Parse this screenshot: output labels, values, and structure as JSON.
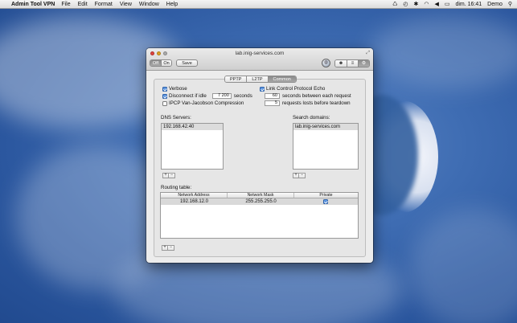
{
  "menubar": {
    "app_name": "Admin Tool VPN",
    "menus": [
      "File",
      "Edit",
      "Format",
      "View",
      "Window",
      "Help"
    ],
    "clock": "dim. 16:41",
    "user": "Demo"
  },
  "window": {
    "title": "lab.inig-services.com",
    "toggle": {
      "off_label": "Off",
      "on_label": "On",
      "selected": "Off"
    },
    "save_label": "Save",
    "tabs": [
      {
        "label": "PPTP",
        "selected": false
      },
      {
        "label": "L2TP",
        "selected": false
      },
      {
        "label": "Common",
        "selected": true
      }
    ]
  },
  "common": {
    "verbose": {
      "label": "Verbose",
      "checked": true
    },
    "disconnect_idle": {
      "label": "Disconnect if idle",
      "value": "7 200",
      "suffix": "seconds",
      "checked": true
    },
    "ipcp": {
      "label": "IPCP Van-Jacobson Compression",
      "checked": false
    },
    "lcp_echo": {
      "label": "Link Control Protocol Echo",
      "checked": true
    },
    "echo_interval": {
      "value": "60",
      "suffix": "seconds between each request"
    },
    "echo_failures": {
      "value": "5",
      "suffix": "requests losts before teardown"
    },
    "dns_label": "DNS Servers:",
    "dns_servers": [
      "192.168.42.40"
    ],
    "search_label": "Search domains:",
    "search_domains": [
      "lab.inig-services.com"
    ],
    "routing_label": "Routing table:",
    "routing_columns": [
      "Network Address",
      "Network Mask",
      "Private"
    ],
    "routes": [
      {
        "address": "192.168.12.0",
        "mask": "255.255.255.0",
        "private": true
      }
    ],
    "plus": "+",
    "minus": "−"
  },
  "colors": {
    "accent": "#2f73d0",
    "selected_tab": "#9a9a9a"
  }
}
